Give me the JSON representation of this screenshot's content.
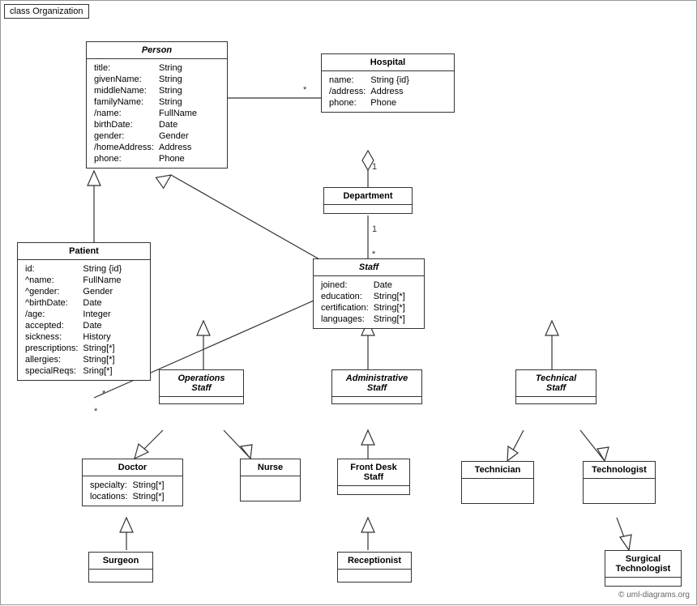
{
  "diagram": {
    "title": "class Organization",
    "copyright": "© uml-diagrams.org"
  },
  "classes": {
    "person": {
      "name": "Person",
      "italic": true,
      "attrs": [
        [
          "title:",
          "String"
        ],
        [
          "givenName:",
          "String"
        ],
        [
          "middleName:",
          "String"
        ],
        [
          "familyName:",
          "String"
        ],
        [
          "/name:",
          "FullName"
        ],
        [
          "birthDate:",
          "Date"
        ],
        [
          "gender:",
          "Gender"
        ],
        [
          "/homeAddress:",
          "Address"
        ],
        [
          "phone:",
          "Phone"
        ]
      ]
    },
    "hospital": {
      "name": "Hospital",
      "italic": false,
      "attrs": [
        [
          "name:",
          "String {id}"
        ],
        [
          "/address:",
          "Address"
        ],
        [
          "phone:",
          "Phone"
        ]
      ]
    },
    "patient": {
      "name": "Patient",
      "italic": false,
      "attrs": [
        [
          "id:",
          "String {id}"
        ],
        [
          "^name:",
          "FullName"
        ],
        [
          "^gender:",
          "Gender"
        ],
        [
          "^birthDate:",
          "Date"
        ],
        [
          "/age:",
          "Integer"
        ],
        [
          "accepted:",
          "Date"
        ],
        [
          "sickness:",
          "History"
        ],
        [
          "prescriptions:",
          "String[*]"
        ],
        [
          "allergies:",
          "String[*]"
        ],
        [
          "specialReqs:",
          "Sring[*]"
        ]
      ]
    },
    "department": {
      "name": "Department",
      "italic": false,
      "attrs": []
    },
    "staff": {
      "name": "Staff",
      "italic": true,
      "attrs": [
        [
          "joined:",
          "Date"
        ],
        [
          "education:",
          "String[*]"
        ],
        [
          "certification:",
          "String[*]"
        ],
        [
          "languages:",
          "String[*]"
        ]
      ]
    },
    "operations_staff": {
      "name": "Operations\nStaff",
      "italic": true,
      "attrs": []
    },
    "administrative_staff": {
      "name": "Administrative\nStaff",
      "italic": true,
      "attrs": []
    },
    "technical_staff": {
      "name": "Technical\nStaff",
      "italic": true,
      "attrs": []
    },
    "doctor": {
      "name": "Doctor",
      "italic": false,
      "attrs": [
        [
          "specialty:",
          "String[*]"
        ],
        [
          "locations:",
          "String[*]"
        ]
      ]
    },
    "nurse": {
      "name": "Nurse",
      "italic": false,
      "attrs": []
    },
    "front_desk_staff": {
      "name": "Front Desk\nStaff",
      "italic": false,
      "attrs": []
    },
    "technician": {
      "name": "Technician",
      "italic": false,
      "attrs": []
    },
    "technologist": {
      "name": "Technologist",
      "italic": false,
      "attrs": []
    },
    "surgeon": {
      "name": "Surgeon",
      "italic": false,
      "attrs": []
    },
    "receptionist": {
      "name": "Receptionist",
      "italic": false,
      "attrs": []
    },
    "surgical_technologist": {
      "name": "Surgical\nTechnologist",
      "italic": false,
      "attrs": []
    }
  }
}
